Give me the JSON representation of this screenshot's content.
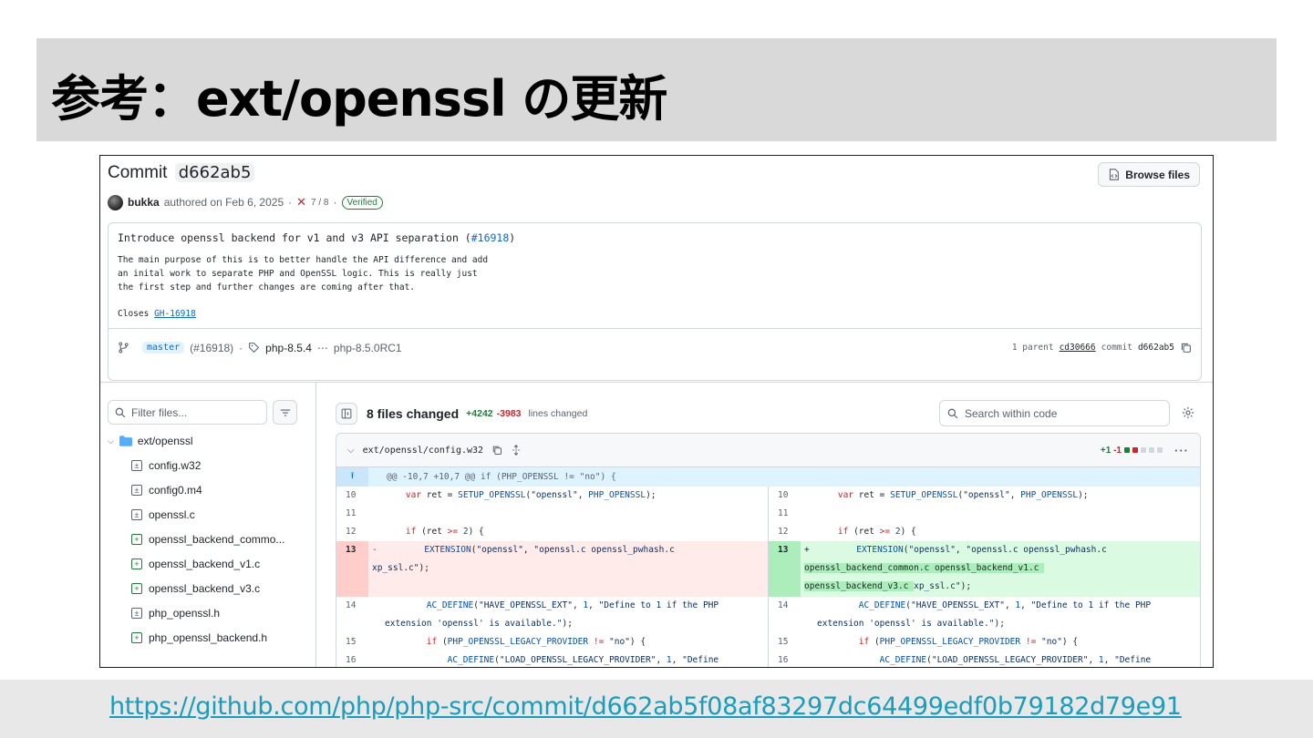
{
  "slide": {
    "title": "参考：ext/openssl の更新",
    "url": "https://github.com/php/php-src/commit/d662ab5f08af83297dc64499edf0b79182d79e91"
  },
  "commit": {
    "label": "Commit",
    "sha_short": "d662ab5",
    "browse_files": "Browse files",
    "author": "bukka",
    "authored_on": "authored on Feb 6, 2025",
    "checks": "7 / 8",
    "verified": "Verified",
    "message_title_prefix": "Introduce openssl backend for v1 and v3 API separation (",
    "message_title_link": "#16918",
    "message_title_suffix": ")",
    "message_body": "The main purpose of this is to better handle the API difference and add\nan inital work to separate PHP and OpenSSL logic. This is really just\nthe first step and further changes are coming after that.",
    "closes_label": "Closes",
    "closes_link": "GH-16918",
    "branch": "master",
    "branch_pr": "(#16918)",
    "tag_start": "php-8.5.4",
    "tag_end": "php-8.5.0RC1",
    "parent_label": "1 parent",
    "parent_sha": "cd30666",
    "commit_label": "commit",
    "commit_sha": "d662ab5"
  },
  "tree": {
    "filter_placeholder": "Filter files...",
    "folder": "ext/openssl",
    "files": [
      {
        "name": "config.w32",
        "status": "modified"
      },
      {
        "name": "config0.m4",
        "status": "modified"
      },
      {
        "name": "openssl.c",
        "status": "modified"
      },
      {
        "name": "openssl_backend_commo...",
        "status": "added"
      },
      {
        "name": "openssl_backend_v1.c",
        "status": "added"
      },
      {
        "name": "openssl_backend_v3.c",
        "status": "added"
      },
      {
        "name": "php_openssl.h",
        "status": "modified"
      },
      {
        "name": "php_openssl_backend.h",
        "status": "added"
      }
    ]
  },
  "diff": {
    "files_changed": "8 files changed",
    "additions": "+4242",
    "deletions": "-3983",
    "lines_changed": "lines changed",
    "search_placeholder": "Search within code",
    "file_path": "ext/openssl/config.w32",
    "file_stat": "+1 -1",
    "hunk_header": "@@ -10,7 +10,7 @@ if (PHP_OPENSSL != \"no\") {",
    "colors": {
      "add": "#dafbe1",
      "del": "#ffebe9",
      "hunk": "#ddf4ff"
    }
  }
}
